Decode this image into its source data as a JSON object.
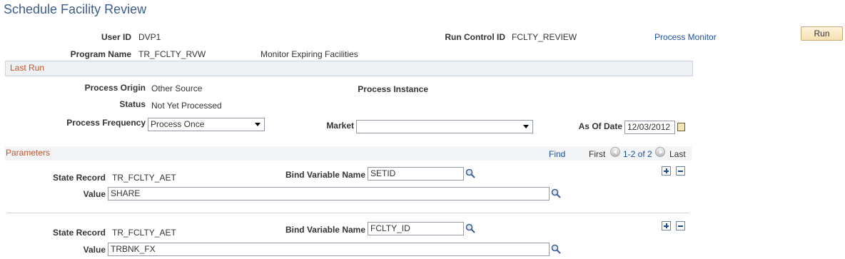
{
  "page": {
    "title": "Schedule Facility Review"
  },
  "header": {
    "user_id_label": "User ID",
    "user_id_value": "DVP1",
    "run_control_label": "Run Control ID",
    "run_control_value": "FCLTY_REVIEW",
    "process_monitor_link": "Process Monitor",
    "run_button": "Run",
    "program_name_label": "Program Name",
    "program_name_value": "TR_FCLTY_RVW",
    "program_description": "Monitor Expiring Facilities"
  },
  "last_run": {
    "section_title": "Last Run",
    "process_origin_label": "Process Origin",
    "process_origin_value": "Other Source",
    "process_instance_label": "Process Instance",
    "status_label": "Status",
    "status_value": "Not Yet Processed",
    "frequency_label": "Process Frequency",
    "frequency_value": "Process Once",
    "market_label": "Market",
    "market_value": "",
    "as_of_date_label": "As Of Date",
    "as_of_date_value": "12/03/2012"
  },
  "parameters": {
    "section_title": "Parameters",
    "find_link": "Find",
    "first_label": "First",
    "range_link": "1-2 of 2",
    "last_label": "Last",
    "rows": [
      {
        "state_record_label": "State Record",
        "state_record_value": "TR_FCLTY_AET",
        "bind_variable_label": "Bind Variable Name",
        "bind_variable_value": "SETID",
        "value_label": "Value",
        "value_value": "SHARE"
      },
      {
        "state_record_label": "State Record",
        "state_record_value": "TR_FCLTY_AET",
        "bind_variable_label": "Bind Variable Name",
        "bind_variable_value": "FCLTY_ID",
        "value_label": "Value",
        "value_value": "TRBNK_FX"
      }
    ]
  },
  "icons": {
    "lookup": "magnifier-icon",
    "calendar": "calendar-icon",
    "add_row": "plus-icon",
    "delete_row": "minus-icon",
    "nav_prev": "left-arrow-icon",
    "nav_next": "right-arrow-icon"
  },
  "colors": {
    "title": "#3b5d8a",
    "section_title": "#c2552a",
    "link": "#1b4f99",
    "run_button_bg": "#f7dfb2"
  }
}
